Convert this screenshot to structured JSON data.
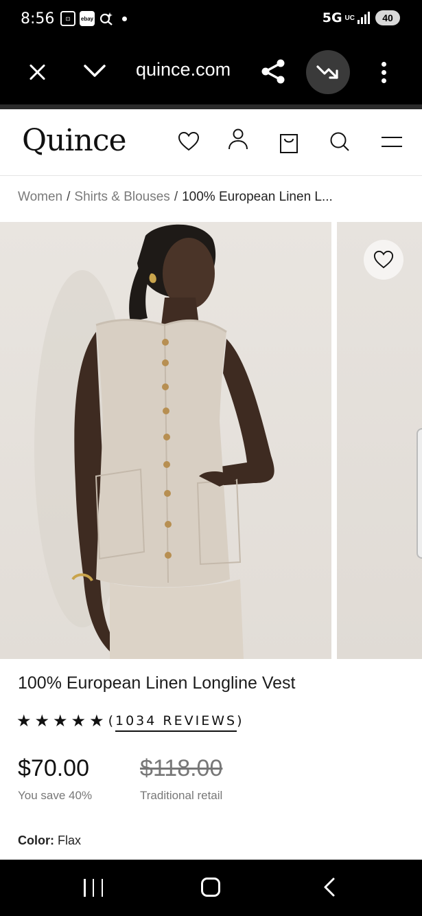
{
  "status_bar": {
    "time": "8:56",
    "network": "5G",
    "network_sub": "UC",
    "battery": "40",
    "icons": [
      "screenshot-icon",
      "ebay-icon",
      "search-sparkle-icon",
      "notification-dot-icon"
    ]
  },
  "browser": {
    "url": "quince.com",
    "icons": [
      "close-icon",
      "chevron-down-icon",
      "share-icon",
      "trend-down-icon",
      "more-vert-icon"
    ]
  },
  "header": {
    "logo": "Quince",
    "icons": [
      "heart-icon",
      "user-icon",
      "bag-icon",
      "search-icon",
      "menu-icon"
    ]
  },
  "breadcrumb": {
    "items": [
      "Women",
      "Shirts & Blouses",
      "100% European Linen L..."
    ],
    "separator": "/"
  },
  "product": {
    "title": "100% European Linen Longline Vest",
    "stars": 5,
    "reviews_open": "(",
    "reviews_text": "1034 REVIEWS",
    "reviews_close": ")",
    "price": "$70.00",
    "retail_price": "$118.00",
    "savings": "You save 40%",
    "retail_label": "Traditional retail",
    "color_label": "Color:",
    "color_value": "Flax"
  },
  "colors": {
    "background": "#ffffff",
    "bars": "#000000",
    "text": "#1b1b1b",
    "muted": "#777777",
    "linen": "#d8cfc3"
  }
}
